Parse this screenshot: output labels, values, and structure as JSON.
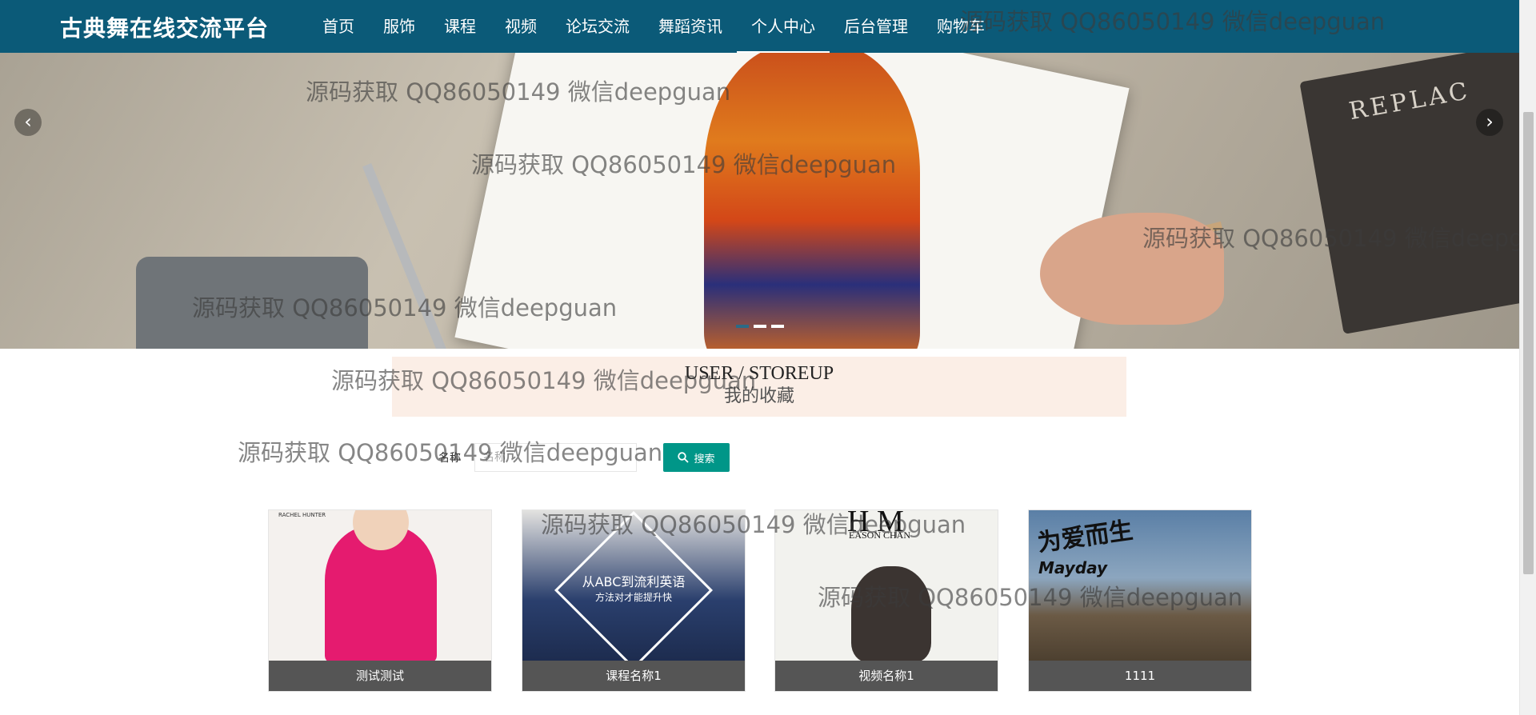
{
  "brand": "古典舞在线交流平台",
  "nav": [
    {
      "label": "首页"
    },
    {
      "label": "服饰"
    },
    {
      "label": "课程"
    },
    {
      "label": "视频"
    },
    {
      "label": "论坛交流"
    },
    {
      "label": "舞蹈资讯"
    },
    {
      "label": "个人中心",
      "active": true
    },
    {
      "label": "后台管理"
    },
    {
      "label": "购物车"
    }
  ],
  "banner": {
    "prev_icon": "‹",
    "next_icon": "›",
    "book_text": "REPLAC",
    "slides": 3,
    "active_slide": 0
  },
  "section": {
    "title_en": "USER / STOREUP",
    "title_cn": "我的收藏"
  },
  "search": {
    "label": "名称",
    "placeholder": "名称",
    "button_label": "搜索",
    "button_color": "#009688"
  },
  "cards": [
    {
      "caption": "测试测试",
      "image_text": "RACHEL HUNTER"
    },
    {
      "caption": "课程名称1",
      "image_text_1": "从ABC到流利英语",
      "image_text_2": "方法对才能提升快"
    },
    {
      "caption": "视频名称1",
      "image_text_1": "H M",
      "image_text_2": "EASON CHAN"
    },
    {
      "caption": "1111",
      "image_text_1": "为爱而生",
      "image_text_2": "Mayday"
    }
  ],
  "watermark": "源码获取 QQ86050149 微信deepguan",
  "colors": {
    "nav_bg": "#0b5a78",
    "section_bg": "#fbeee6",
    "caption_bg": "#555555"
  }
}
